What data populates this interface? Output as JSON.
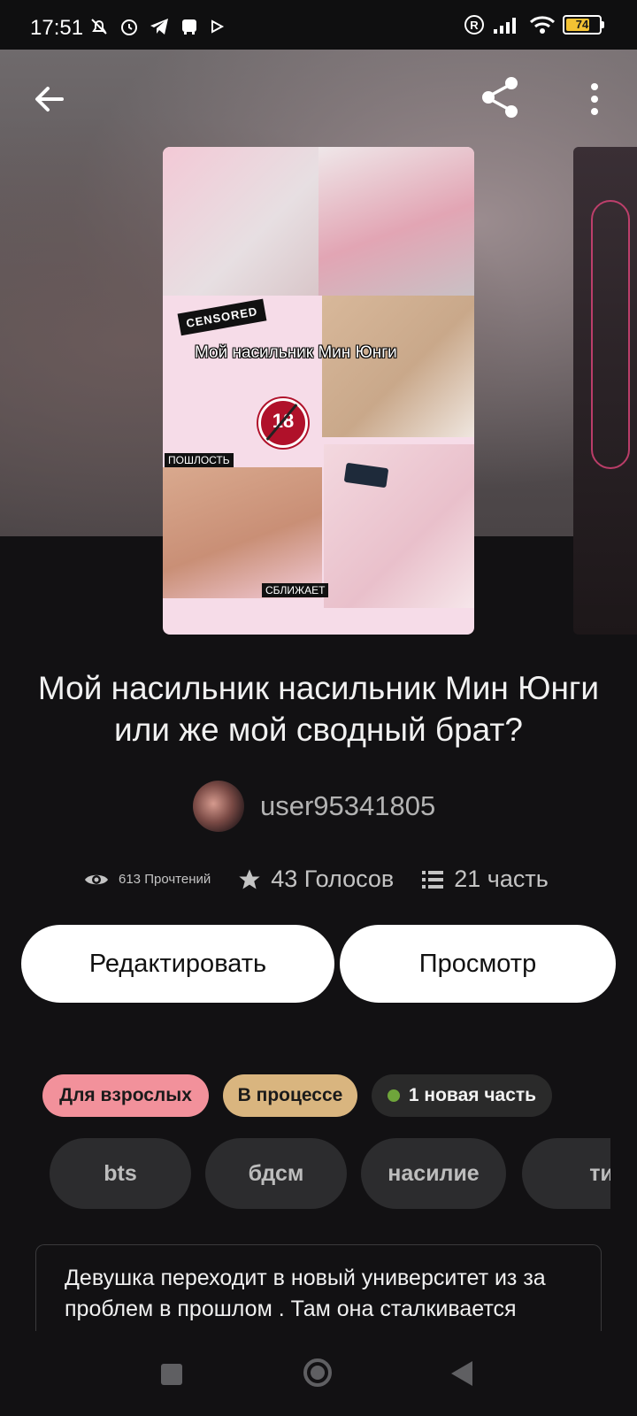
{
  "status_bar": {
    "time": "17:51",
    "battery_level": "74",
    "icons_left": [
      "mute-icon",
      "alarm-icon",
      "telegram-icon",
      "bag-icon",
      "play-icon"
    ],
    "icons_right": [
      "registered-icon",
      "signal-icon",
      "wifi-icon",
      "battery-icon"
    ]
  },
  "header": {
    "icons": [
      "back-arrow-icon",
      "share-icon",
      "more-vert-icon"
    ]
  },
  "cover": {
    "censored_label": "CENSORED",
    "title_overlay": "Мой насильник Мин Юнги",
    "age_badge": "18",
    "word_left": "ПОШЛОСТЬ",
    "word_bottom": "СБЛИЖАЕТ"
  },
  "story": {
    "title": "Мой  насильник насильник Мин Юнги или же мой сводный брат?",
    "author": "user95341805",
    "reads": "613 Прочтений",
    "votes": "43 Голосов",
    "parts": "21 часть"
  },
  "actions": {
    "edit_label": "Редактировать",
    "view_label": "Просмотр"
  },
  "chips": {
    "adult": "Для взрослых",
    "progress": "В процессе",
    "new_part": "1 новая часть"
  },
  "tags": [
    "bts",
    "бдсм",
    "насилие",
    "ти"
  ],
  "description": "Девушка переходит в новый университет из за проблем  в прошлом . Там она сталкивается",
  "colors": {
    "background": "#121113",
    "adult_chip": "#f2919b",
    "progress_chip": "#d9b57f",
    "new_dot": "#6fa53b",
    "tag_bg": "#2c2c2e"
  },
  "navbar": {
    "icons": [
      "recents-square-icon",
      "home-circle-icon",
      "back-triangle-icon"
    ]
  }
}
